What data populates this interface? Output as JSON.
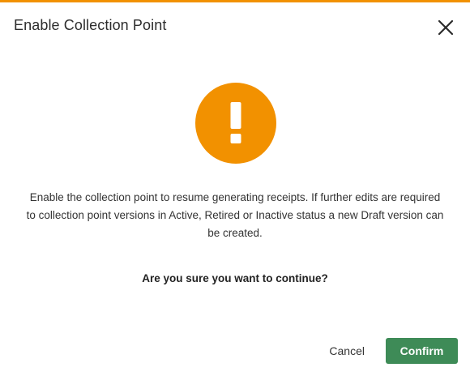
{
  "dialog": {
    "title": "Enable Collection Point",
    "close_icon": "close-icon",
    "status_icon": "exclamation-warning-icon",
    "status_color": "#f29100",
    "message": "Enable the collection point to resume generating receipts. If further edits are required to collection point versions in Active, Retired or Inactive status a new Draft version can be created.",
    "question": "Are you sure you want to continue?",
    "cancel_label": "Cancel",
    "confirm_label": "Confirm",
    "confirm_color": "#3e8b57"
  }
}
